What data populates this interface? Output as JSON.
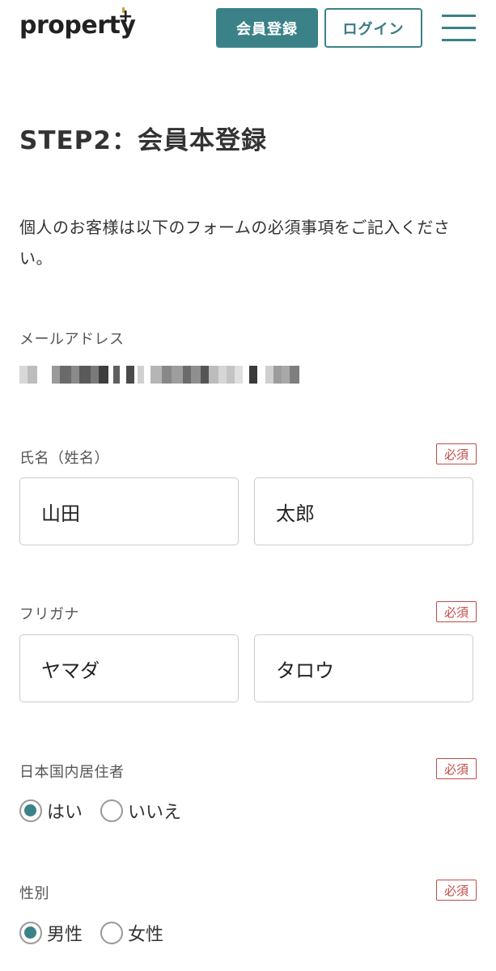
{
  "header": {
    "logo": "property",
    "logo_plus": "+",
    "register_label": "会員登録",
    "login_label": "ログイン"
  },
  "page": {
    "title": "STEP2：会員本登録",
    "intro": "個人のお客様は以下のフォームの必須事項をご記入ください。"
  },
  "form": {
    "email": {
      "label": "メールアドレス"
    },
    "name": {
      "label": "氏名（姓名）",
      "required": "必須",
      "last_name": "山田",
      "first_name": "太郎"
    },
    "furigana": {
      "label": "フリガナ",
      "required": "必須",
      "last_name": "ヤマダ",
      "first_name": "タロウ"
    },
    "resident": {
      "label": "日本国内居住者",
      "required": "必須",
      "options": [
        "はい",
        "いいえ"
      ],
      "selected": "はい"
    },
    "gender": {
      "label": "性別",
      "required": "必須",
      "options": [
        "男性",
        "女性"
      ],
      "selected": "男性"
    }
  },
  "colors": {
    "accent": "#3a8288",
    "required": "#c14b47"
  }
}
